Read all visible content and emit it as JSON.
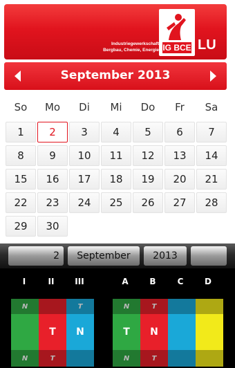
{
  "header": {
    "union_line1": "Industriegewerkschaft",
    "union_line2": "Bergbau, Chemie, Energie",
    "logo_text": "IG BCE",
    "region": "LU"
  },
  "calendar": {
    "month_title": "September 2013",
    "weekdays": [
      "So",
      "Mo",
      "Di",
      "Mi",
      "Do",
      "Fr",
      "Sa"
    ],
    "selected_day": "2",
    "weeks": [
      [
        "1",
        "2",
        "3",
        "4",
        "5",
        "6",
        "7"
      ],
      [
        "8",
        "9",
        "10",
        "11",
        "12",
        "13",
        "14"
      ],
      [
        "15",
        "16",
        "17",
        "18",
        "19",
        "20",
        "21"
      ],
      [
        "22",
        "23",
        "24",
        "25",
        "26",
        "27",
        "28"
      ],
      [
        "29",
        "30",
        "",
        "",
        "",
        "",
        ""
      ]
    ]
  },
  "picker": {
    "day": "2",
    "month": "September",
    "year": "2013"
  },
  "shifts": {
    "labels": [
      "I",
      "II",
      "III",
      "A",
      "B",
      "C",
      "D"
    ],
    "left_wheel": [
      {
        "color": "#2fa843",
        "top": "N",
        "mid": "",
        "bot": "N"
      },
      {
        "color": "#e8202a",
        "top": "",
        "mid": "T",
        "bot": "T"
      },
      {
        "color": "#1aa8d8",
        "top": "T",
        "mid": "N",
        "bot": ""
      }
    ],
    "right_wheel": [
      {
        "color": "#2fa843",
        "top": "N",
        "mid": "T",
        "bot": "N"
      },
      {
        "color": "#e8202a",
        "top": "T",
        "mid": "N",
        "bot": "T"
      },
      {
        "color": "#1aa8d8",
        "top": "",
        "mid": "",
        "bot": ""
      },
      {
        "color": "#f2ea1a",
        "top": "",
        "mid": "",
        "bot": ""
      }
    ]
  }
}
